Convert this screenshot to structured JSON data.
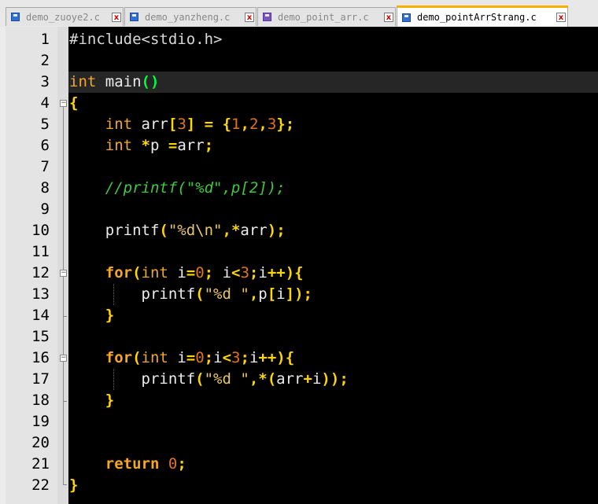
{
  "tabs": [
    {
      "label": "demo_zuoye2.c",
      "active": false,
      "icon": "save-disk-icon"
    },
    {
      "label": "demo_yanzheng.c",
      "active": false,
      "icon": "save-disk-icon"
    },
    {
      "label": "demo_point_arr.c",
      "active": false,
      "icon": "save-disk-purple-icon"
    },
    {
      "label": "demo_pointArrStrang.c",
      "active": true,
      "icon": "save-disk-icon"
    }
  ],
  "tab_close_glyph": "x",
  "line_numbers": [
    "1",
    "2",
    "3",
    "4",
    "5",
    "6",
    "7",
    "8",
    "9",
    "10",
    "11",
    "12",
    "13",
    "14",
    "15",
    "16",
    "17",
    "18",
    "19",
    "20",
    "21",
    "22"
  ],
  "fold_markers": {
    "open": "−"
  },
  "code": {
    "l1": {
      "include": "#include<stdio.h>"
    },
    "l3": {
      "type": "int",
      "name": " main",
      "parens": "()"
    },
    "l4": {
      "brace": "{"
    },
    "l5": {
      "type": "int",
      "arr": " arr",
      "lb": "[",
      "n3": "3",
      "rb": "]",
      "sp": " ",
      "eq": "=",
      "sp2": " ",
      "lc": "{",
      "n1": "1",
      "c1": ",",
      "n2": "2",
      "c2": ",",
      "n3b": "3",
      "rc": "}",
      "semi": ";"
    },
    "l6": {
      "type": "int",
      "sp": " ",
      "star": "*",
      "p": "p ",
      "eq": "=",
      "arr": "arr",
      "semi": ";"
    },
    "l8": {
      "comment": "//printf(\"%d\",p[2]);"
    },
    "l10": {
      "fn": "printf",
      "lp": "(",
      "str": "\"%d\\n\"",
      "comma": ",",
      "star": "*",
      "arr": "arr",
      "rp": ")",
      "semi": ";"
    },
    "l12": {
      "kw": "for",
      "lp": "(",
      "type": "int",
      "i": " i",
      "eq": "=",
      "n0": "0",
      "semi1": ";",
      "sp": " i",
      "lt": "<",
      "n3": "3",
      "semi2": ";",
      "i2": "i",
      "pp": "++",
      "rp": ")",
      "lb": "{"
    },
    "l13": {
      "fn": "printf",
      "lp": "(",
      "str": "\"%d \"",
      "comma": ",",
      "p": "p",
      "lb": "[",
      "i": "i",
      "rb": "]",
      "rp": ")",
      "semi": ";"
    },
    "l14": {
      "rb": "}"
    },
    "l16": {
      "kw": "for",
      "lp": "(",
      "type": "int",
      "i": " i",
      "eq": "=",
      "n0": "0",
      "semi1": ";",
      "i1": "i",
      "lt": "<",
      "n3": "3",
      "semi2": ";",
      "i2": "i",
      "pp": "++",
      "rp": ")",
      "lb": "{"
    },
    "l17": {
      "fn": "printf",
      "lp": "(",
      "str": "\"%d \"",
      "comma": ",",
      "star": "*",
      "lp2": "(",
      "arr": "arr",
      "plus": "+",
      "i": "i",
      "rp2": ")",
      "rp": ")",
      "semi": ";"
    },
    "l18": {
      "rb": "}"
    },
    "l21": {
      "kw": "return",
      "sp": " ",
      "n0": "0",
      "semi": ";"
    },
    "l22": {
      "rb": "}"
    }
  },
  "colors": {
    "editor_bg": "#000000",
    "keyword": "#f5a623",
    "number": "#e0741a",
    "operator": "#ffd700",
    "comment": "#3ec93e",
    "active_tab_accent": "#fab000"
  }
}
